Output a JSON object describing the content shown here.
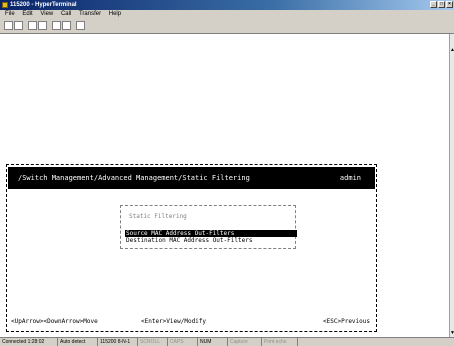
{
  "window": {
    "title": "115200 - HyperTerminal"
  },
  "menu": [
    "File",
    "Edit",
    "View",
    "Call",
    "Transfer",
    "Help"
  ],
  "terminal": {
    "header_path": "/Switch Management/Advanced Management/Static Filtering",
    "header_user": "admin",
    "menu_title": "Static Filtering",
    "items": [
      "Source MAC Address Out-Filters",
      "Destination MAC Address Out-Filters"
    ],
    "footer": {
      "nav": "<UpArrow><DownArrow>Move",
      "enter": "<Enter>View/Modify",
      "esc": "<ESC>Previous"
    }
  },
  "status": {
    "connected": "Connected 1:28:02",
    "detect": "Auto detect",
    "settings": "115200 8-N-1",
    "scroll": "SCROLL",
    "caps": "CAPS",
    "num": "NUM",
    "capture": "Capture",
    "echo": "Print echo"
  }
}
